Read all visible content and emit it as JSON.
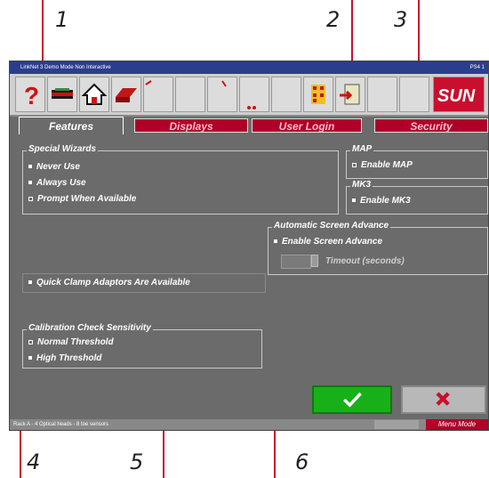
{
  "callouts": [
    "1",
    "2",
    "3",
    "4",
    "5",
    "6"
  ],
  "app": {
    "title": "LinkNet 3   Demo Mode   Non Interactive",
    "title_right": "PS4 1",
    "brand": "SUN",
    "tabs": [
      {
        "label": "Features",
        "active": true
      },
      {
        "label": "Displays",
        "active": false
      },
      {
        "label": "User Login",
        "active": false
      },
      {
        "label": "Security",
        "active": false
      }
    ],
    "wizards": {
      "title": "Special Wizards",
      "options": [
        "Never Use",
        "Always Use",
        "Prompt When Available"
      ],
      "selected": 0
    },
    "map": {
      "title": "MAP",
      "option": "Enable MAP"
    },
    "mk3": {
      "title": "MK3",
      "option": "Enable MK3"
    },
    "screen_advance": {
      "title": "Automatic Screen Advance",
      "option": "Enable Screen Advance",
      "timeout_label": "Timeout (seconds)",
      "timeout_value": ""
    },
    "quick_clamp": {
      "label": "Quick Clamp Adaptors Are Available"
    },
    "calibration": {
      "title": "Calibration Check Sensitivity",
      "options": [
        "Normal Threshold",
        "High Threshold"
      ],
      "selected": 1
    },
    "status_text": "Rack A - 4 Optical heads - 8 toe sensors",
    "menu_mode": "Menu Mode",
    "colors": {
      "accent_red": "#b0002a",
      "ok_green": "#18b018",
      "panel": "#6b6b6b"
    }
  }
}
